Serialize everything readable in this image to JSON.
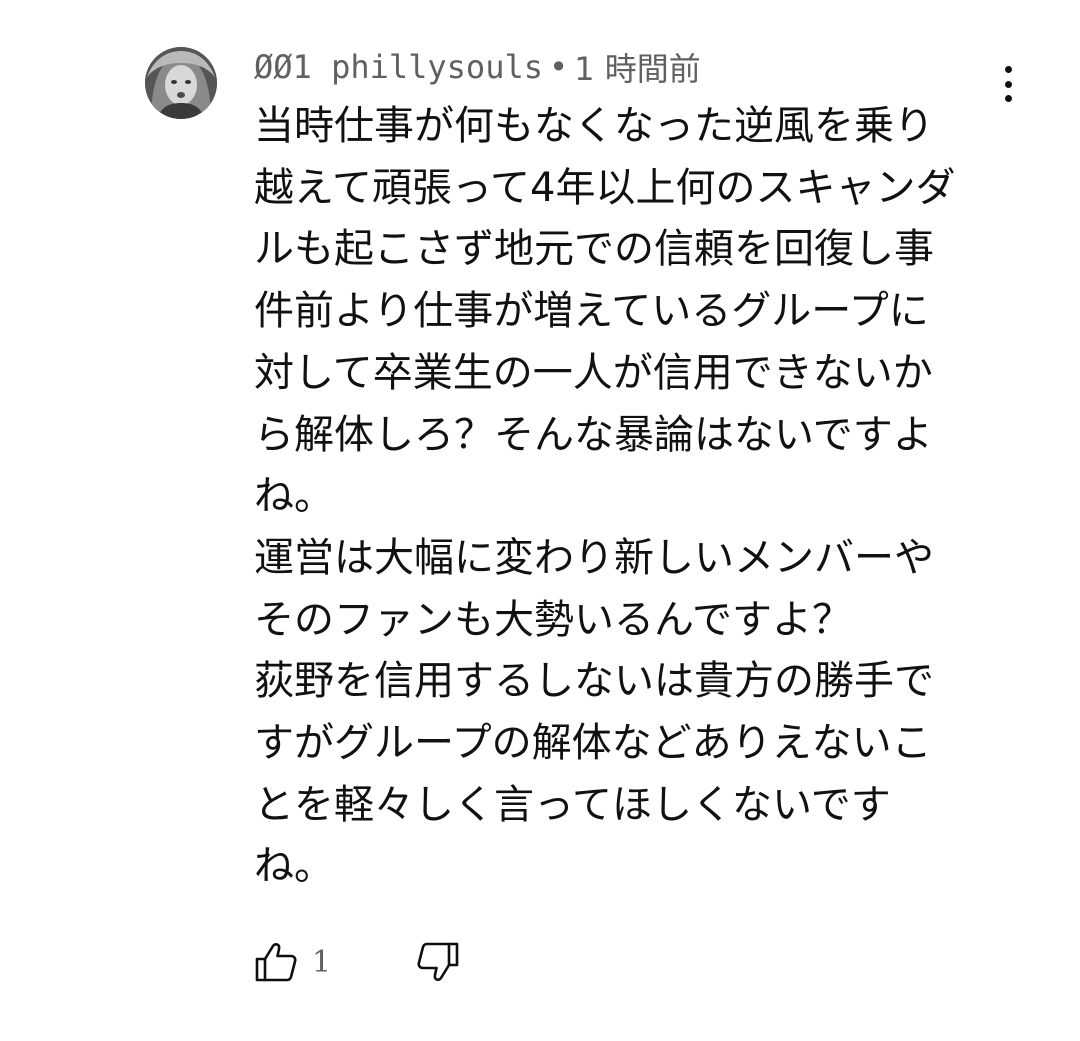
{
  "comment": {
    "author": "ØØ1 phillysouls",
    "separator": "•",
    "timestamp": "1 時間前",
    "text": "当時仕事が何もなくなった逆風を乗り\n越えて頑張って4年以上何のスキャンダ\nルも起こさず地元での信頼を回復し事\n件前より仕事が増えているグループに\n対して卒業生の一人が信用できないか\nら解体しろ？そんな暴論はないですよ\nね。\n運営は大幅に変わり新しいメンバーや\nそのファンも大勢いるんですよ？\n荻野を信用するしないは貴方の勝手で\nすがグループの解体などありえないこ\nとを軽々しく言ってほしくないです\nね。",
    "like_count": "1",
    "icons": {
      "avatar": "avatar",
      "more": "more-vert-icon",
      "like": "thumb-up-icon",
      "dislike": "thumb-down-icon"
    }
  }
}
